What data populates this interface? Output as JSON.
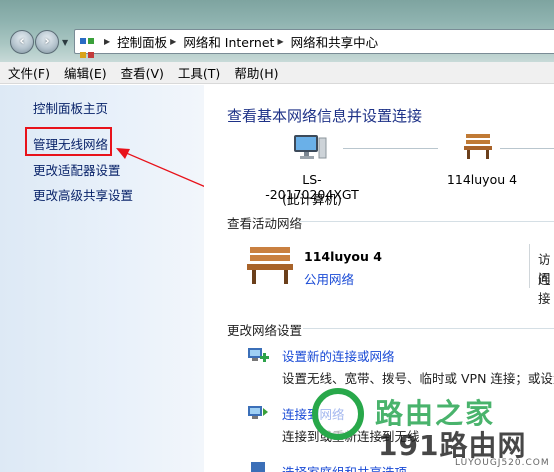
{
  "address": {
    "crumbs": [
      "控制面板",
      "网络和 Internet",
      "网络和共享中心"
    ]
  },
  "menu": [
    "文件(F)",
    "编辑(E)",
    "查看(V)",
    "工具(T)",
    "帮助(H)"
  ],
  "left_nav": {
    "items": [
      "控制面板主页",
      "管理无线网络",
      "更改适配器设置",
      "更改高级共享设置"
    ]
  },
  "main": {
    "heading": "查看基本网络信息并设置连接",
    "computer_name": "LS--20170204XGT",
    "computer_sub": "(此计算机)",
    "network_name_top": "114luyou  4",
    "active_title": "查看活动网络",
    "active_network": {
      "name": "114luyou  4",
      "type": "公用网络",
      "right_cut_1": "访问",
      "right_cut_2": "连接"
    },
    "change_title": "更改网络设置",
    "tasks": [
      {
        "link": "设置新的连接或网络",
        "desc": "设置无线、宽带、拨号、临时或 VPN 连接；或设置"
      },
      {
        "link": "连接到网络",
        "desc": "连接到或重新连接到无线"
      },
      {
        "link": "选择家庭组和共享选项",
        "desc": ""
      }
    ]
  },
  "watermark": {
    "line1": "路由之家",
    "line2": "191路由网",
    "site": "LUYOUGJ520.COM"
  },
  "colors": {
    "highlight": "#e8121a",
    "link": "#1a4bd6",
    "heading": "#1e3287"
  }
}
